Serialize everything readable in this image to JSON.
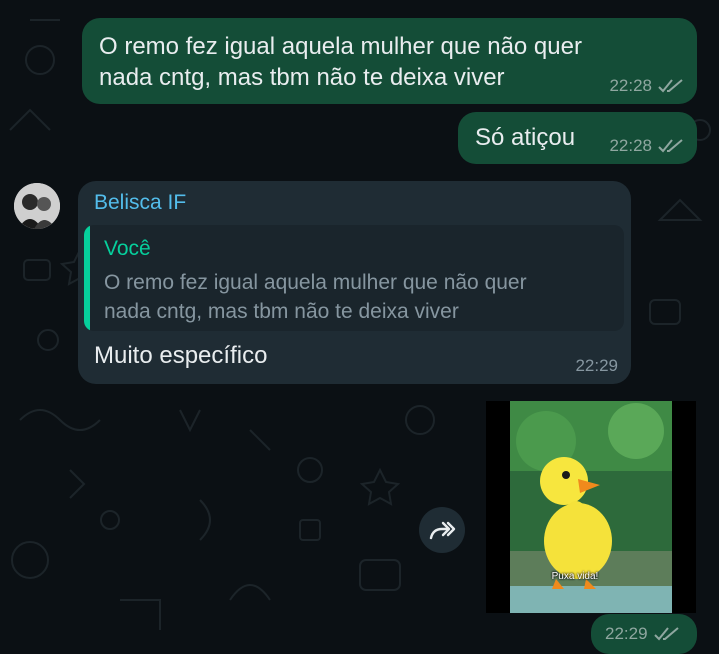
{
  "messages": [
    {
      "direction": "outgoing",
      "text": "O remo fez igual aquela mulher que não quer\nnada cntg, mas tbm não te deixa viver",
      "time": "22:28",
      "status": "read"
    },
    {
      "direction": "outgoing",
      "text": "Só atiçou",
      "time": "22:28",
      "status": "read"
    },
    {
      "direction": "incoming",
      "sender": "Belisca IF",
      "quoted": {
        "author": "Você",
        "text": "O remo fez igual aquela mulher que não quer\nnada cntg, mas tbm não te deixa viver"
      },
      "text": "Muito específico",
      "time": "22:29"
    },
    {
      "direction": "incoming",
      "type": "gif",
      "caption": "Puxa vida!",
      "time": "22:29",
      "status": "read"
    }
  ],
  "colors": {
    "outgoing_bubble": "#144d37",
    "incoming_bubble": "#1f2c34",
    "sender_name": "#53bdeb",
    "quote_accent": "#06cf9c",
    "read_ticks": "#8fa7a0"
  },
  "icons": {
    "read_receipt": "double-check-icon",
    "forward": "forward-arrow-icon",
    "avatar": "contact-avatar"
  }
}
